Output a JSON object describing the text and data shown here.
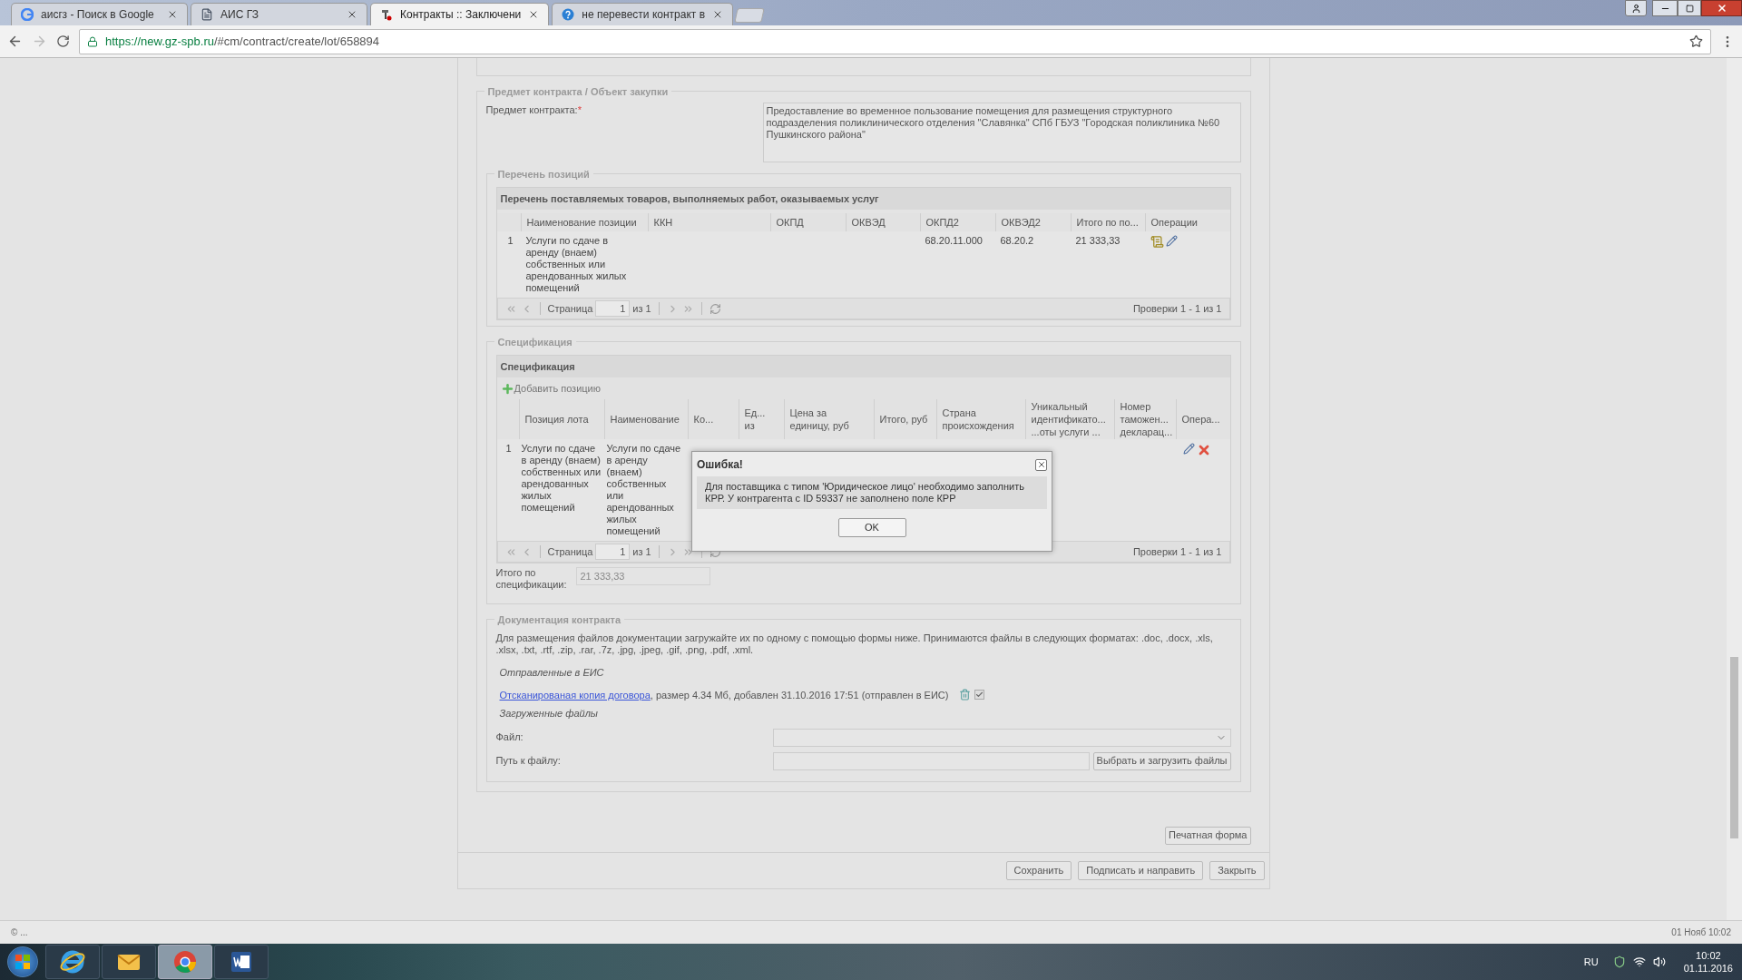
{
  "browser": {
    "tabs": [
      {
        "title": "аисгз - Поиск в Google",
        "selected": false,
        "kind": "google"
      },
      {
        "title": "АИС ГЗ",
        "selected": false,
        "kind": "page"
      },
      {
        "title": "Контракты :: Заключени",
        "selected": true,
        "kind": "tool"
      },
      {
        "title": "не перевести контракт в",
        "selected": false,
        "kind": "help"
      }
    ],
    "url_host": "https://new.gz-spb.ru",
    "url_path": "/#cm/contract/create/lot/658894"
  },
  "subject": {
    "legend": "Предмет контракта / Объект закупки",
    "label": "Предмет контракта:",
    "required_mark": "*",
    "value": "Предоставление во временное пользование помещения для размещения структурного подразделения поликлинического отделения \"Славянка\" СПб ГБУЗ \"Городская поликлиника №60 Пушкинского района\""
  },
  "positions": {
    "legend": "Перечень позиций",
    "title": "Перечень поставляемых товаров, выполняемых работ, оказываемых услуг",
    "columns": [
      "Наименование позиции",
      "ККН",
      "ОКПД",
      "ОКВЭД",
      "ОКПД2",
      "ОКВЭД2",
      "Итого по по...",
      "Операции"
    ],
    "rows": [
      {
        "number": "1",
        "cells": [
          "Услуги по сдаче в аренду (внаем) собственных или арендованных жилых помещений",
          "",
          "",
          "",
          "68.20.11.000",
          "68.20.2",
          "21 333,33"
        ]
      }
    ],
    "pager": {
      "page_label": "Страница",
      "page": "1",
      "of": "из 1",
      "summary": "Проверки 1 - 1 из 1"
    }
  },
  "specification": {
    "legend": "Спецификация",
    "title": "Спецификация",
    "add_button": "Добавить позицию",
    "columns": [
      "Позиция лота",
      "Наименование",
      "Ко...",
      "Ед... из",
      "Цена за единицу, руб",
      "Итого, руб",
      "Страна происхождения",
      "Уникальный идентификато... ...оты услуги ...",
      "Номер таможен... декларац...",
      "Опера..."
    ],
    "rows": [
      {
        "number": "1",
        "cells": [
          "Услуги по сдаче в аренду (внаем) собственных или арендованных жилых помещений",
          "Услуги по сдаче в аренду (внаем) собственных или арендованных жилых помещений"
        ]
      }
    ],
    "pager": {
      "page_label": "Страница",
      "page": "1",
      "of": "из 1",
      "summary": "Проверки 1 - 1 из 1"
    },
    "total_label": "Итого по спецификации:",
    "total_value": "21 333,33"
  },
  "documents": {
    "legend": "Документация контракта",
    "intro": "Для размещения файлов документации загружайте их по одному с помощью формы ниже. Принимаются файлы в следующих форматах: .doc, .docx, .xls, .xlsx, .txt, .rtf, .zip, .rar, .7z, .jpg, .jpeg, .gif, .png, .pdf, .xml.",
    "sent_heading": "Отправленные в ЕИС",
    "files": [
      {
        "link": "Отсканированая копия договора",
        "details": ", размер 4.34 Мб, добавлен 31.10.2016 17:51 (отправлен в ЕИС)",
        "checked": true
      }
    ],
    "uploaded_heading": "Загруженные файлы",
    "file_label": "Файл:",
    "path_label": "Путь к файлу:",
    "upload_button": "Выбрать и загрузить файлы"
  },
  "print_button": "Печатная форма",
  "actions": [
    "Сохранить",
    "Подписать и направить",
    "Закрыть"
  ],
  "dialog": {
    "title": "Ошибка!",
    "message": "Для поставщика с типом 'Юридическое лицо' необходимо заполнить КРР. У контрагента с ID 59337 не заполнено поле КРР",
    "ok": "OK"
  },
  "status_bar": {
    "left": "© ...",
    "right": "01 Нояб 10:02"
  },
  "taskbar": {
    "apps": [
      {
        "kind": "ie",
        "selected": false
      },
      {
        "kind": "mail",
        "selected": false
      },
      {
        "kind": "chrome",
        "selected": true
      },
      {
        "kind": "word",
        "selected": false
      }
    ],
    "language": "RU",
    "time": "10:02",
    "date": "01.11.2016"
  }
}
